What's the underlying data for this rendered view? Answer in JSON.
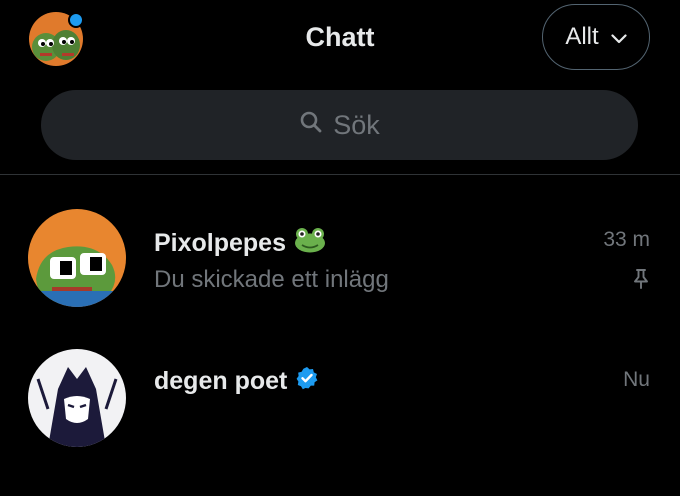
{
  "header": {
    "title": "Chatt",
    "filter_label": "Allt"
  },
  "search": {
    "placeholder": "Sök"
  },
  "conversations": [
    {
      "name": "Pixolpepes",
      "name_emoji": "frog-emoji",
      "preview": "Du skickade ett inlägg",
      "time": "33 m",
      "pinned": true
    },
    {
      "name": "degen poet",
      "verified": true,
      "time": "Nu"
    }
  ],
  "colors": {
    "background": "#000000",
    "accent": "#1d9bf0",
    "search_bg": "#202327",
    "muted_text": "#71767b"
  }
}
